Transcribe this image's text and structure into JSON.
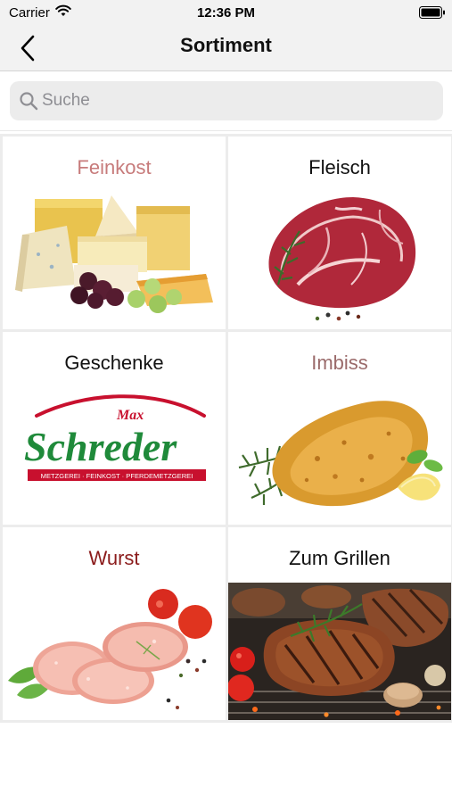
{
  "status_bar": {
    "carrier": "Carrier",
    "time": "12:36 PM",
    "wifi_icon": "wifi-icon",
    "battery_icon": "battery-icon"
  },
  "nav": {
    "title": "Sortiment",
    "back_icon": "chevron-left-icon"
  },
  "search": {
    "placeholder": "Suche",
    "value": "",
    "icon": "search-icon"
  },
  "categories": [
    {
      "label": "Feinkost",
      "label_color": "#c77b7b",
      "image": "cheese"
    },
    {
      "label": "Fleisch",
      "label_color": "#111111",
      "image": "raw-meat"
    },
    {
      "label": "Geschenke",
      "label_color": "#111111",
      "image": "schreder-logo"
    },
    {
      "label": "Imbiss",
      "label_color": "#9a6a6a",
      "image": "schnitzel"
    },
    {
      "label": "Wurst",
      "label_color": "#8b1c1c",
      "image": "sliced-sausage"
    },
    {
      "label": "Zum Grillen",
      "label_color": "#111111",
      "image": "grilled-steaks"
    }
  ],
  "logo": {
    "top_text": "Max",
    "name": "Schreder",
    "tagline": "METZGEREI · FEINKOST · PFERDEMETZGEREI"
  },
  "colors": {
    "bar_background": "#f2f2f2",
    "logo_green": "#1f8a3a",
    "logo_red": "#c8102e"
  }
}
